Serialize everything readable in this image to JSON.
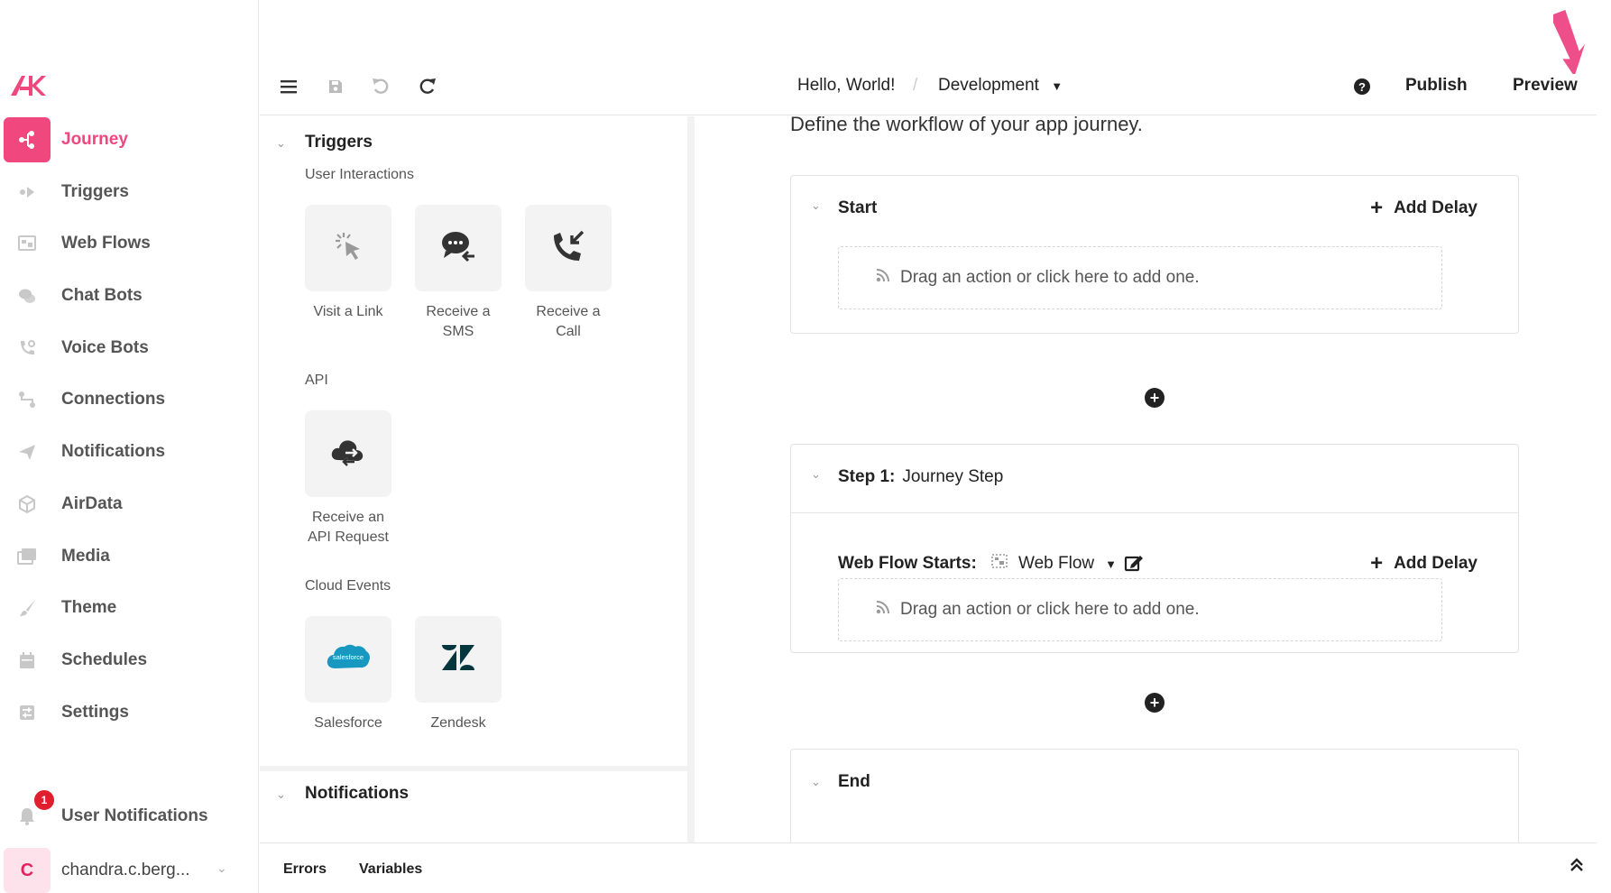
{
  "brand": {
    "accent": "#f0477f",
    "logo_text": "AK"
  },
  "sidebar": {
    "items": [
      {
        "label": "Journey",
        "icon": "journey-icon",
        "active": true
      },
      {
        "label": "Triggers",
        "icon": "triggers-icon"
      },
      {
        "label": "Web Flows",
        "icon": "web-flows-icon"
      },
      {
        "label": "Chat Bots",
        "icon": "chat-bots-icon"
      },
      {
        "label": "Voice Bots",
        "icon": "voice-bots-icon"
      },
      {
        "label": "Connections",
        "icon": "connections-icon"
      },
      {
        "label": "Notifications",
        "icon": "notifications-icon"
      },
      {
        "label": "AirData",
        "icon": "airdata-icon"
      },
      {
        "label": "Media",
        "icon": "media-icon"
      },
      {
        "label": "Theme",
        "icon": "theme-icon"
      },
      {
        "label": "Schedules",
        "icon": "schedules-icon"
      },
      {
        "label": "Settings",
        "icon": "settings-icon"
      }
    ],
    "user_notifications": {
      "label": "User Notifications",
      "badge_count": "1"
    },
    "account": {
      "initial": "C",
      "name": "chandra.c.berg..."
    }
  },
  "topbar": {
    "app_name": "Hello, World!",
    "separator": "/",
    "environment": "Development",
    "publish_label": "Publish",
    "preview_label": "Preview"
  },
  "panel": {
    "triggers": {
      "title": "Triggers",
      "groups": {
        "user_interactions": "User Interactions",
        "api": "API",
        "cloud_events": "Cloud Events"
      },
      "tiles": {
        "visit_link": "Visit a Link",
        "receive_sms_1": "Receive a",
        "receive_sms_2": "SMS",
        "receive_call_1": "Receive a",
        "receive_call_2": "Call",
        "api_request_1": "Receive an",
        "api_request_2": "API Request",
        "salesforce": "Salesforce",
        "salesforce_logo": "salesforce",
        "zendesk": "Zendesk"
      }
    },
    "notifications": {
      "title": "Notifications"
    }
  },
  "canvas": {
    "description": "Define the workflow of your app journey.",
    "start": {
      "title": "Start",
      "add_delay": "Add Delay",
      "dropzone": "Drag an action or click here to add one."
    },
    "step1": {
      "title": "Step 1:",
      "name": "Journey Step",
      "web_flow_starts_label": "Web Flow Starts:",
      "web_flow_value": "Web Flow",
      "add_delay": "Add Delay",
      "dropzone": "Drag an action or click here to add one."
    },
    "end": {
      "title": "End"
    }
  },
  "bottombar": {
    "errors": "Errors",
    "variables": "Variables"
  }
}
